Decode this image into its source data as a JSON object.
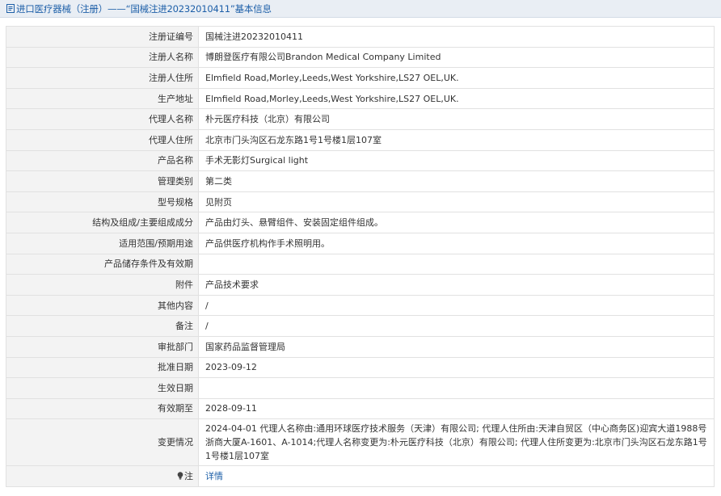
{
  "header": {
    "title": "进口医疗器械（注册）——“国械注进20232010411”基本信息",
    "icon": "document-icon"
  },
  "rows": [
    {
      "label": "注册证编号",
      "value": "国械注进20232010411"
    },
    {
      "label": "注册人名称",
      "value": "博朗登医疗有限公司Brandon Medical Company Limited"
    },
    {
      "label": "注册人住所",
      "value": "Elmfield Road,Morley,Leeds,West Yorkshire,LS27 OEL,UK."
    },
    {
      "label": "生产地址",
      "value": "Elmfield Road,Morley,Leeds,West Yorkshire,LS27 OEL,UK."
    },
    {
      "label": "代理人名称",
      "value": "朴元医疗科技（北京）有限公司"
    },
    {
      "label": "代理人住所",
      "value": "北京市门头沟区石龙东路1号1号楼1层107室"
    },
    {
      "label": "产品名称",
      "value": "手术无影灯Surgical light"
    },
    {
      "label": "管理类别",
      "value": "第二类"
    },
    {
      "label": "型号规格",
      "value": "见附页"
    },
    {
      "label": "结构及组成/主要组成成分",
      "value": "产品由灯头、悬臂组件、安装固定组件组成。"
    },
    {
      "label": "适用范围/预期用途",
      "value": "产品供医疗机构作手术照明用。"
    },
    {
      "label": "产品储存条件及有效期",
      "value": ""
    },
    {
      "label": "附件",
      "value": "产品技术要求"
    },
    {
      "label": "其他内容",
      "value": "/"
    },
    {
      "label": "备注",
      "value": "/"
    },
    {
      "label": "审批部门",
      "value": "国家药品监督管理局"
    },
    {
      "label": "批准日期",
      "value": "2023-09-12"
    },
    {
      "label": "生效日期",
      "value": ""
    },
    {
      "label": "有效期至",
      "value": "2028-09-11"
    },
    {
      "label": "变更情况",
      "value": "2024-04-01 代理人名称由:通用环球医疗技术服务（天津）有限公司; 代理人住所由:天津自贸区（中心商务区)迎宾大道1988号浙商大厦A-1601、A-1014;代理人名称变更为:朴元医疗科技（北京）有限公司; 代理人住所变更为:北京市门头沟区石龙东路1号1号楼1层107室"
    }
  ],
  "note_row": {
    "label": "注",
    "icon": "lightbulb-icon",
    "link_text": "详情"
  },
  "colors": {
    "header_bg": "#e9eef4",
    "title_text": "#1d5fa8",
    "label_bg": "#f3f3f3",
    "border": "#e1e1e1",
    "link": "#1d5fa8"
  }
}
